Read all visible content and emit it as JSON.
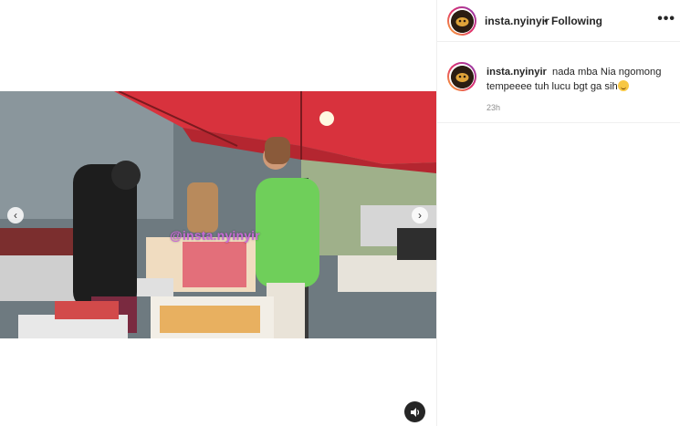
{
  "post": {
    "username": "insta.nyinyir",
    "separator": "•",
    "follow_state": "Following",
    "more_label": "•••"
  },
  "caption": {
    "username": "insta.nyinyir",
    "text": "nada mba Nia ngomong tempeeee tuh lucu bgt ga sih",
    "emoji": "grinning-face-emoji",
    "timestamp": "23h"
  },
  "media": {
    "watermark": "@insta.nyinyir",
    "prev_icon": "chevron-left-icon",
    "next_icon": "chevron-right-icon",
    "audio_icon": "speaker-icon",
    "prev_glyph": "‹",
    "next_glyph": "›"
  },
  "colors": {
    "text": "#262626",
    "muted": "#8e8e8e",
    "border": "#efefef",
    "avatar_ring_start": "#f9b233",
    "avatar_ring_end": "#833ab4",
    "watermark": "#c86ad6"
  }
}
